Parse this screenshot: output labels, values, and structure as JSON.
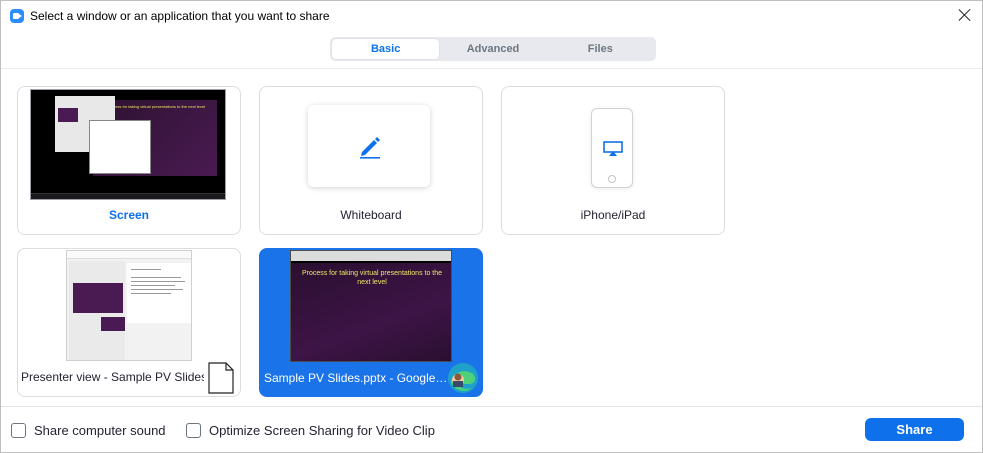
{
  "window": {
    "title": "Select a window or an application that you want to share"
  },
  "tabs": [
    {
      "label": "Basic",
      "active": true
    },
    {
      "label": "Advanced",
      "active": false
    },
    {
      "label": "Files",
      "active": false
    }
  ],
  "tiles": [
    {
      "label": "Screen",
      "icon": "screen-thumbnail"
    },
    {
      "label": "Whiteboard",
      "icon": "pencil-icon"
    },
    {
      "label": "iPhone/iPad",
      "icon": "airplay-icon"
    },
    {
      "label": "Presenter view - Sample PV Slides...",
      "icon": "document-icon"
    },
    {
      "label": "Sample PV Slides.pptx - Google S...",
      "icon": "edge-icon",
      "selected": true
    }
  ],
  "slide": {
    "text": "Process for taking virtual presentations to the next level"
  },
  "bottom": {
    "share_sound_label": "Share computer sound",
    "optimize_label": "Optimize Screen Sharing for Video Clip",
    "share_button": "Share"
  },
  "colors": {
    "accent": "#0e71eb",
    "selected_tile": "#1a73e8",
    "slide_bg": "#4a1a52",
    "slide_text": "#f4e86a"
  }
}
